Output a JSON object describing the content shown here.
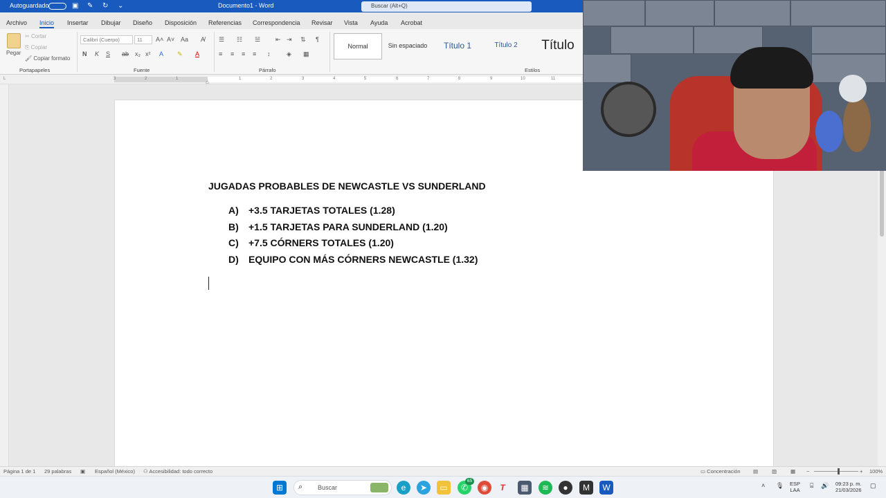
{
  "titlebar": {
    "autosave": "Autoguardado",
    "doc_title": "Documento1 - Word",
    "search_placeholder": "Buscar (Alt+Q)"
  },
  "tabs": [
    "Archivo",
    "Inicio",
    "Insertar",
    "Dibujar",
    "Diseño",
    "Disposición",
    "Referencias",
    "Correspondencia",
    "Revisar",
    "Vista",
    "Ayuda",
    "Acrobat"
  ],
  "active_tab": "Inicio",
  "ribbon": {
    "clipboard": {
      "paste": "Pegar",
      "cut": "Cortar",
      "copy": "Copiar",
      "format_painter": "Copiar formato",
      "label": "Portapapeles"
    },
    "font": {
      "family": "Calibri (Cuerpo)",
      "size": "11",
      "label": "Fuente"
    },
    "paragraph": {
      "label": "Párrafo"
    },
    "styles": {
      "items": [
        "Normal",
        "Sin espaciado",
        "Título 1",
        "Título 2",
        "Título"
      ],
      "label": "Estilos"
    }
  },
  "ruler": {
    "ticks": [
      "3",
      "2",
      "1",
      "1",
      "2",
      "3",
      "4",
      "5",
      "6",
      "7",
      "8",
      "9",
      "10",
      "11"
    ]
  },
  "document": {
    "title": "JUGADAS PROBABLES DE NEWCASTLE VS SUNDERLAND",
    "items": [
      {
        "marker": "A)",
        "text": "+3.5 TARJETAS TOTALES (1.28)"
      },
      {
        "marker": "B)",
        "text": "+1.5 TARJETAS PARA SUNDERLAND (1.20)"
      },
      {
        "marker": "C)",
        "text": "+7.5 CÓRNERS TOTALES (1.20)"
      },
      {
        "marker": "D)",
        "text": "EQUIPO CON MÁS CÓRNERS NEWCASTLE (1.32)"
      }
    ]
  },
  "statusbar": {
    "page": "Página 1 de 1",
    "words": "29 palabras",
    "language": "Español (México)",
    "accessibility": "Accesibilidad: todo correcto",
    "focus": "Concentración",
    "zoom": "100%"
  },
  "taskbar": {
    "search_placeholder": "Buscar",
    "whatsapp_badge": "65",
    "lang_top": "ESP",
    "lang_bottom": "LAA",
    "time": "09:23 p. m.",
    "date": "21/03/2026",
    "colors": {
      "windows": "#0078d4",
      "edge": "#1aa0c8",
      "telegram": "#2aa3df",
      "files": "#f2c23a",
      "whatsapp": "#25d366",
      "chrome": "#de4b39",
      "typora": "#d9382f",
      "calculator": "#4c5a70",
      "spotify": "#1db954",
      "mail": "#333333",
      "word": "#185abd"
    }
  }
}
